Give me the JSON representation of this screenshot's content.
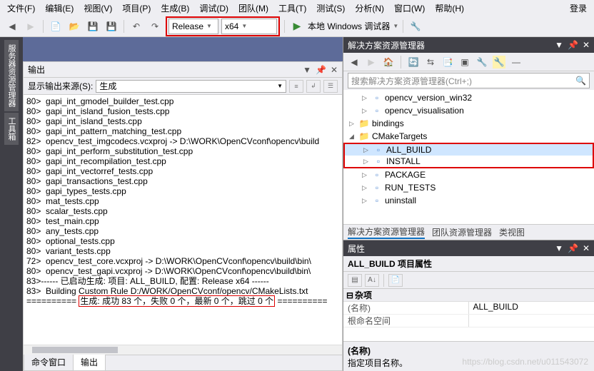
{
  "menu": [
    "文件(F)",
    "编辑(E)",
    "视图(V)",
    "项目(P)",
    "生成(B)",
    "调试(D)",
    "团队(M)",
    "工具(T)",
    "测试(S)",
    "分析(N)",
    "窗口(W)",
    "帮助(H)",
    "登录"
  ],
  "toolbar": {
    "config": "Release",
    "platform": "x64",
    "debugger": "本地 Windows 调试器"
  },
  "left_tabs": [
    "服务器资源管理器",
    "工具箱"
  ],
  "output": {
    "title": "输出",
    "source_label": "显示输出来源(S):",
    "source_value": "生成",
    "lines": [
      "80>  gapi_int_gmodel_builder_test.cpp",
      "80>  gapi_int_island_fusion_tests.cpp",
      "80>  gapi_int_island_tests.cpp",
      "80>  gapi_int_pattern_matching_test.cpp",
      "82>  opencv_test_imgcodecs.vcxproj -> D:\\WORK\\OpenCVconf\\opencv\\build",
      "80>  gapi_int_perform_substitution_test.cpp",
      "80>  gapi_int_recompilation_test.cpp",
      "80>  gapi_int_vectorref_tests.cpp",
      "80>  gapi_transactions_test.cpp",
      "80>  gapi_types_tests.cpp",
      "80>  mat_tests.cpp",
      "80>  scalar_tests.cpp",
      "80>  test_main.cpp",
      "80>  any_tests.cpp",
      "80>  optional_tests.cpp",
      "80>  variant_tests.cpp",
      "72>  opencv_test_core.vcxproj -> D:\\WORK\\OpenCVconf\\opencv\\build\\bin\\",
      "80>  opencv_test_gapi.vcxproj -> D:\\WORK\\OpenCVconf\\opencv\\build\\bin\\",
      "83>------ 已启动生成: 项目: ALL_BUILD, 配置: Release x64 ------",
      "83>  Building Custom Rule D:/WORK/OpenCVconf/opencv/CMakeLists.txt"
    ],
    "summary": "生成: 成功 83 个，失败 0 个，最新 0 个，跳过 0 个",
    "tabs": [
      "命令窗口",
      "输出"
    ]
  },
  "solution": {
    "title": "解决方案资源管理器",
    "search_placeholder": "搜索解决方案资源管理器(Ctrl+;)",
    "nodes": [
      {
        "depth": 1,
        "exp": "▷",
        "icon": "proj",
        "label": "opencv_version_win32"
      },
      {
        "depth": 1,
        "exp": "▷",
        "icon": "proj",
        "label": "opencv_visualisation"
      },
      {
        "depth": 0,
        "exp": "▷",
        "icon": "folder",
        "label": "bindings"
      },
      {
        "depth": 0,
        "exp": "◢",
        "icon": "folder",
        "label": "CMakeTargets"
      },
      {
        "depth": 1,
        "exp": "▷",
        "icon": "proj",
        "label": "ALL_BUILD",
        "sel": true,
        "box": "top"
      },
      {
        "depth": 1,
        "exp": "▷",
        "icon": "proj",
        "label": "INSTALL",
        "box": "bot"
      },
      {
        "depth": 1,
        "exp": "▷",
        "icon": "proj",
        "label": "PACKAGE"
      },
      {
        "depth": 1,
        "exp": "▷",
        "icon": "proj",
        "label": "RUN_TESTS"
      },
      {
        "depth": 1,
        "exp": "▷",
        "icon": "proj",
        "label": "uninstall"
      }
    ],
    "tabs": [
      "解决方案资源管理器",
      "团队资源管理器",
      "类视图"
    ]
  },
  "properties": {
    "title": "属性",
    "subtitle": "ALL_BUILD 项目属性",
    "category": "杂项",
    "rows": [
      {
        "k": "(名称)",
        "v": "ALL_BUILD"
      },
      {
        "k": "根命名空间",
        "v": ""
      }
    ],
    "desc_title": "(名称)",
    "desc_body": "指定项目名称。"
  },
  "watermark": "https://blog.csdn.net/u011543072"
}
